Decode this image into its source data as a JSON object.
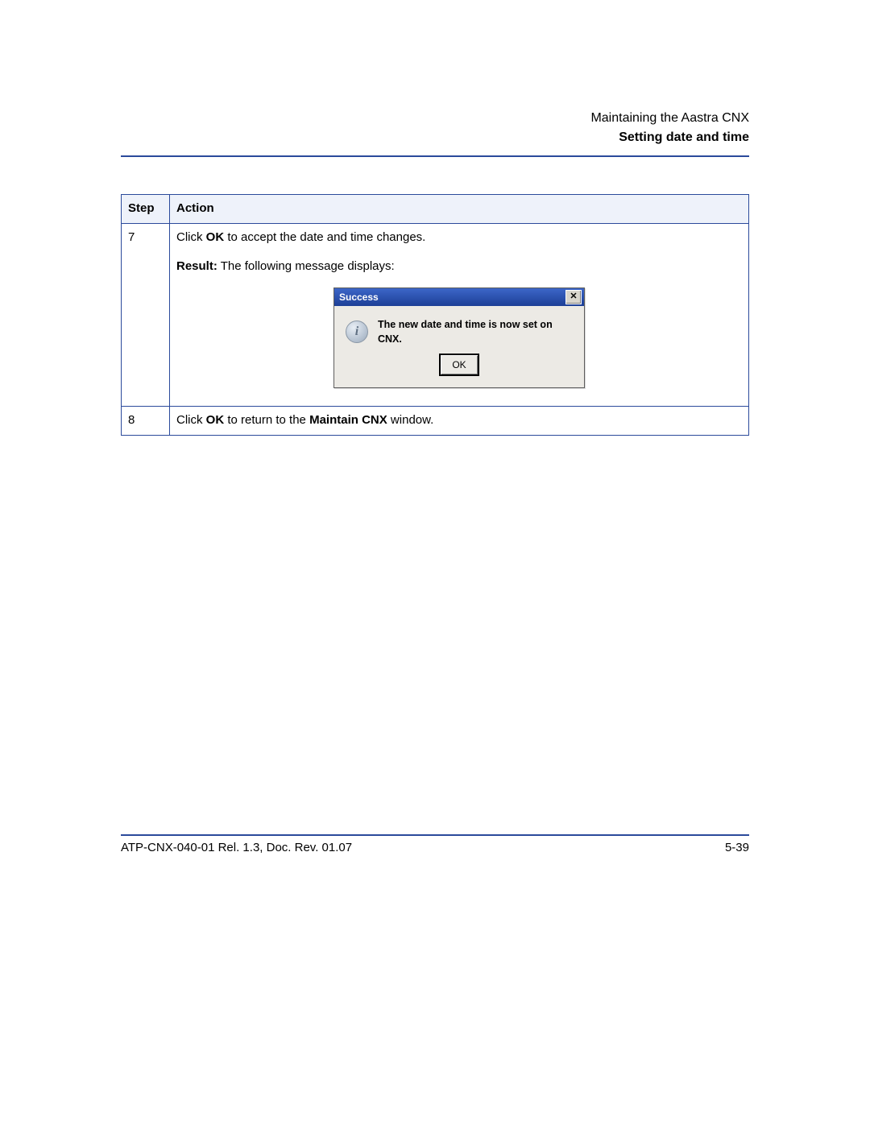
{
  "header": {
    "chapter": "Maintaining the Aastra CNX",
    "section": "Setting date and time"
  },
  "table": {
    "step_header": "Step",
    "action_header": "Action",
    "rows": [
      {
        "step": "7",
        "action_click": "Click ",
        "action_ok": "OK",
        "action_rest": " to accept the date and time changes.",
        "result_label": "Result:",
        "result_rest": " The following message displays:"
      },
      {
        "step": "8",
        "action_click": "Click ",
        "action_ok": "OK",
        "action_mid": " to return to the ",
        "action_win": "Maintain CNX",
        "action_end": " window."
      }
    ]
  },
  "dialog": {
    "title": "Success",
    "close_glyph": "✕",
    "info_glyph": "i",
    "message": "The new date and time is now set on CNX.",
    "button_label": "OK"
  },
  "footer": {
    "doc_id": "ATP-CNX-040-01 Rel. 1.3, Doc. Rev. 01.07",
    "page_no": "5-39"
  }
}
